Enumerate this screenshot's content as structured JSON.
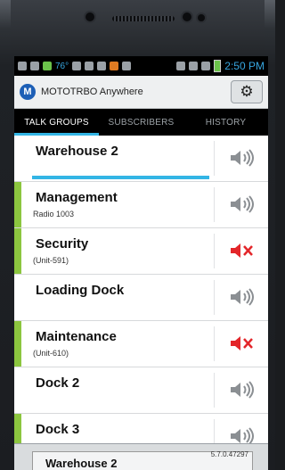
{
  "status_bar": {
    "temperature": "76°",
    "time": "2:50 PM"
  },
  "app": {
    "title": "MOTOTRBO Anywhere",
    "logo_letter": "M"
  },
  "tabs": [
    {
      "label": "TALK GROUPS",
      "active": true
    },
    {
      "label": "SUBSCRIBERS",
      "active": false
    },
    {
      "label": "HISTORY",
      "active": false
    }
  ],
  "talk_groups": [
    {
      "name": "Warehouse 2",
      "subtitle": "",
      "accent": "",
      "speaker": "on",
      "progress": 1.0
    },
    {
      "name": "Management",
      "subtitle": "Radio 1003",
      "accent": "#8cc63f",
      "speaker": "on"
    },
    {
      "name": "Security",
      "subtitle": "(Unit-591)",
      "accent": "#8cc63f",
      "speaker": "muted"
    },
    {
      "name": "Loading Dock",
      "subtitle": "",
      "accent": "",
      "speaker": "on"
    },
    {
      "name": "Maintenance",
      "subtitle": "(Unit-610)",
      "accent": "#8cc63f",
      "speaker": "muted"
    },
    {
      "name": "Dock 2",
      "subtitle": "",
      "accent": "",
      "speaker": "on"
    },
    {
      "name": "Dock 3",
      "subtitle": "",
      "accent": "#8cc63f",
      "speaker": "on"
    }
  ],
  "bottom_panel": {
    "active_channel": "Warehouse 2",
    "version": "5.7.0.47297"
  },
  "colors": {
    "accent_blue": "#33b5e5",
    "status_green": "#8cc63f",
    "mute_red": "#e3262a"
  }
}
